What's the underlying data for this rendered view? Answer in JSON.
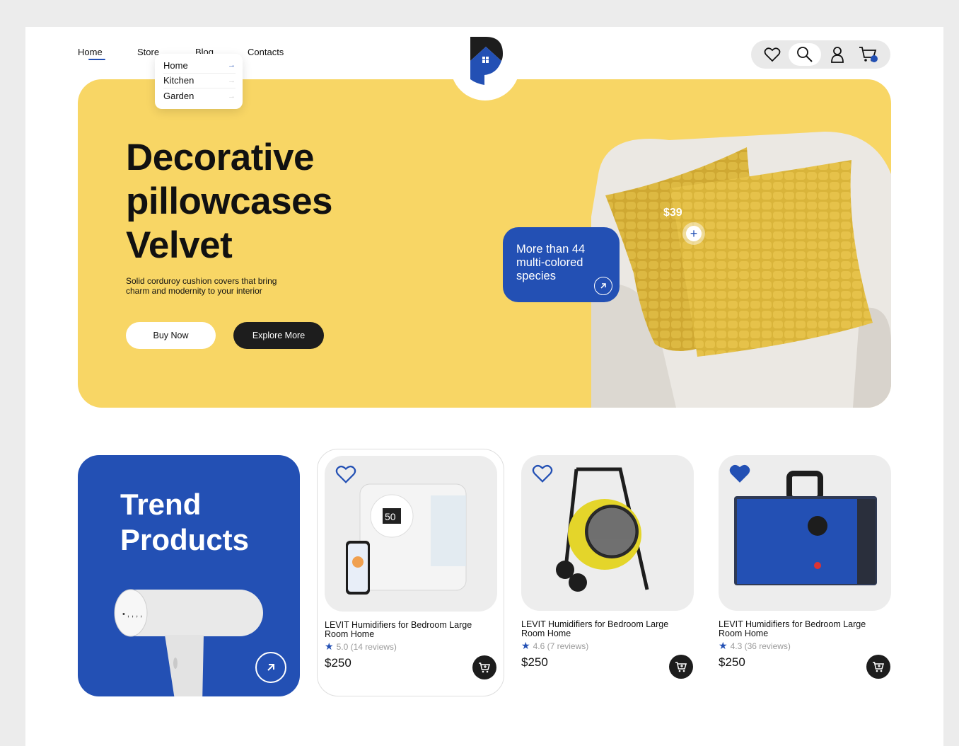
{
  "nav": {
    "items": [
      {
        "label": "Home",
        "active": true
      },
      {
        "label": "Store",
        "active": false
      },
      {
        "label": "Blog",
        "active": false
      },
      {
        "label": "Contacts",
        "active": false
      }
    ],
    "dropdown": [
      "Home",
      "Kitchen",
      "Garden"
    ]
  },
  "header_icons": [
    "heart-icon",
    "search-icon",
    "user-icon",
    "cart-icon"
  ],
  "colors": {
    "accent": "#2350b4",
    "hero_bg": "#f8d665",
    "dark": "#1d1d1d"
  },
  "hero": {
    "title_lines": [
      "Decorative",
      "pillowcases",
      "Velvet"
    ],
    "subtitle_lines": [
      "Solid corduroy cushion covers  that bring",
      "charm and modernity to your interior"
    ],
    "buy_label": "Buy Now",
    "explore_label": "Explore More",
    "promo_lines": [
      "More than 44",
      "multi-colored",
      "species"
    ],
    "price_tag": "$39"
  },
  "trend": {
    "title_lines": [
      "Trend",
      "Products"
    ]
  },
  "products": [
    {
      "name_lines": [
        "LEVIT Humidifiers for Bedroom Large",
        "Room Home"
      ],
      "rating": "5.0 (14 reviews)",
      "price": "$250",
      "favorite": false
    },
    {
      "name_lines": [
        "LEVIT Humidifiers for Bedroom Large",
        "Room Home"
      ],
      "rating": "4.6 (7 reviews)",
      "price": "$250",
      "favorite": false
    },
    {
      "name_lines": [
        "LEVIT Humidifiers for Bedroom Large",
        "Room Home"
      ],
      "rating": "4.3 (36 reviews)",
      "price": "$250",
      "favorite": true
    }
  ]
}
